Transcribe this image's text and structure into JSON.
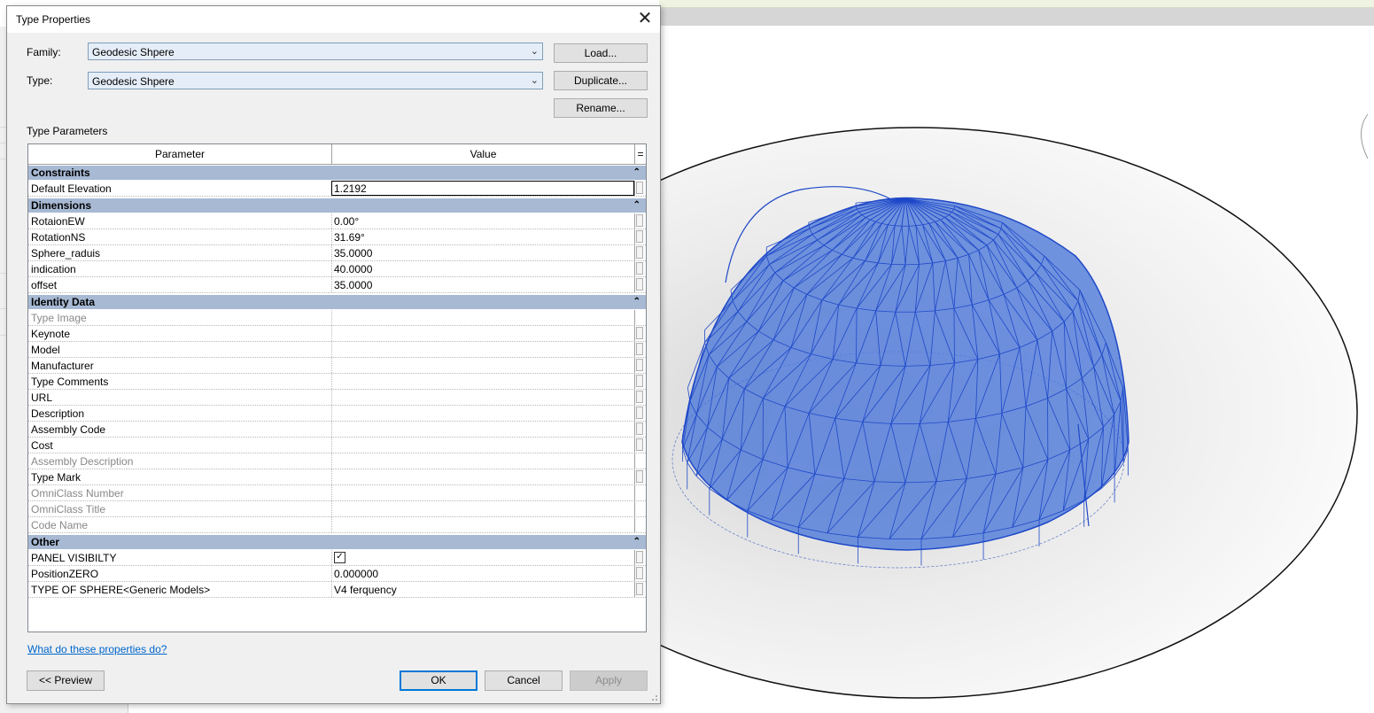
{
  "dialog": {
    "title": "Type Properties",
    "close_glyph": "✕",
    "family_label": "Family:",
    "family_value": "Geodesic Shpere",
    "type_label": "Type:",
    "type_value": "Geodesic Shpere",
    "load_button": "Load...",
    "duplicate_button": "Duplicate...",
    "rename_button": "Rename...",
    "type_parameters_label": "Type Parameters",
    "help_link": "What do these properties do?",
    "preview_button": "<< Preview",
    "ok_button": "OK",
    "cancel_button": "Cancel",
    "apply_button": "Apply"
  },
  "grid": {
    "col_parameter": "Parameter",
    "col_value": "Value",
    "col_sort": "=",
    "collapse_glyph": "⌃",
    "groups": [
      {
        "name": "Constraints",
        "rows": [
          {
            "param": "Default Elevation",
            "value": "1.2192"
          }
        ]
      },
      {
        "name": "Dimensions",
        "rows": [
          {
            "param": "RotaionEW",
            "value": "0.00°"
          },
          {
            "param": "RotationNS",
            "value": "31.69°"
          },
          {
            "param": "Sphere_raduis",
            "value": "35.0000"
          },
          {
            "param": "indication",
            "value": "40.0000"
          },
          {
            "param": "offset",
            "value": "35.0000"
          }
        ]
      },
      {
        "name": "Identity Data",
        "rows": [
          {
            "param": "Type Image",
            "value": ""
          },
          {
            "param": "Keynote",
            "value": ""
          },
          {
            "param": "Model",
            "value": ""
          },
          {
            "param": "Manufacturer",
            "value": ""
          },
          {
            "param": "Type Comments",
            "value": ""
          },
          {
            "param": "URL",
            "value": ""
          },
          {
            "param": "Description",
            "value": ""
          },
          {
            "param": "Assembly Code",
            "value": ""
          },
          {
            "param": "Cost",
            "value": ""
          },
          {
            "param": "Assembly Description",
            "value": ""
          },
          {
            "param": "Type Mark",
            "value": ""
          },
          {
            "param": "OmniClass Number",
            "value": ""
          },
          {
            "param": "OmniClass Title",
            "value": ""
          },
          {
            "param": "Code Name",
            "value": ""
          }
        ]
      },
      {
        "name": "Other",
        "rows": [
          {
            "param": "PANEL VISIBILTY",
            "value": "✓"
          },
          {
            "param": "PositionZERO",
            "value": "0.000000"
          },
          {
            "param": "TYPE OF SPHERE<Generic Models>",
            "value": "V4 ferquency"
          }
        ]
      }
    ]
  },
  "colors": {
    "group_header": "#a7b9d3",
    "combo_bg": "#e5eef8",
    "link": "#0066cc",
    "dome_fill": "#3f6fd8",
    "dome_edge": "#1e48c8"
  }
}
